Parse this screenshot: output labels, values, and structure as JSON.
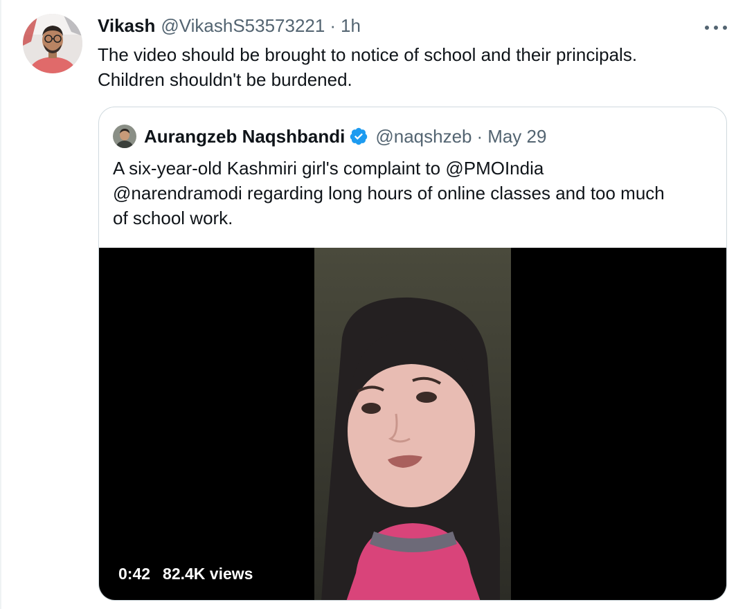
{
  "tweet": {
    "author_name": "Vikash",
    "author_handle": "@VikashS53573221",
    "separator": "·",
    "time": "1h",
    "text_line1": "The video should be brought to notice of school and their principals.",
    "text_line2": "Children shouldn't be burdened.",
    "more_icon": "more-horizontal-icon"
  },
  "quoted": {
    "author_name": "Aurangzeb Naqshbandi",
    "verified_icon": "verified-badge-icon",
    "author_handle": "@naqshzeb",
    "separator": "·",
    "time": "May 29",
    "text_line1": "A six-year-old Kashmiri girl's complaint to @PMOIndia",
    "text_line2": "@narendramodi regarding long hours of online classes and too much",
    "text_line3": "of school work.",
    "video": {
      "duration": "0:42",
      "views": "82.4K views"
    }
  },
  "colors": {
    "text_primary": "#0f1419",
    "text_secondary": "#536471",
    "verified_blue": "#1d9bf0",
    "border": "#cfd9de",
    "video_bg": "#000000"
  }
}
